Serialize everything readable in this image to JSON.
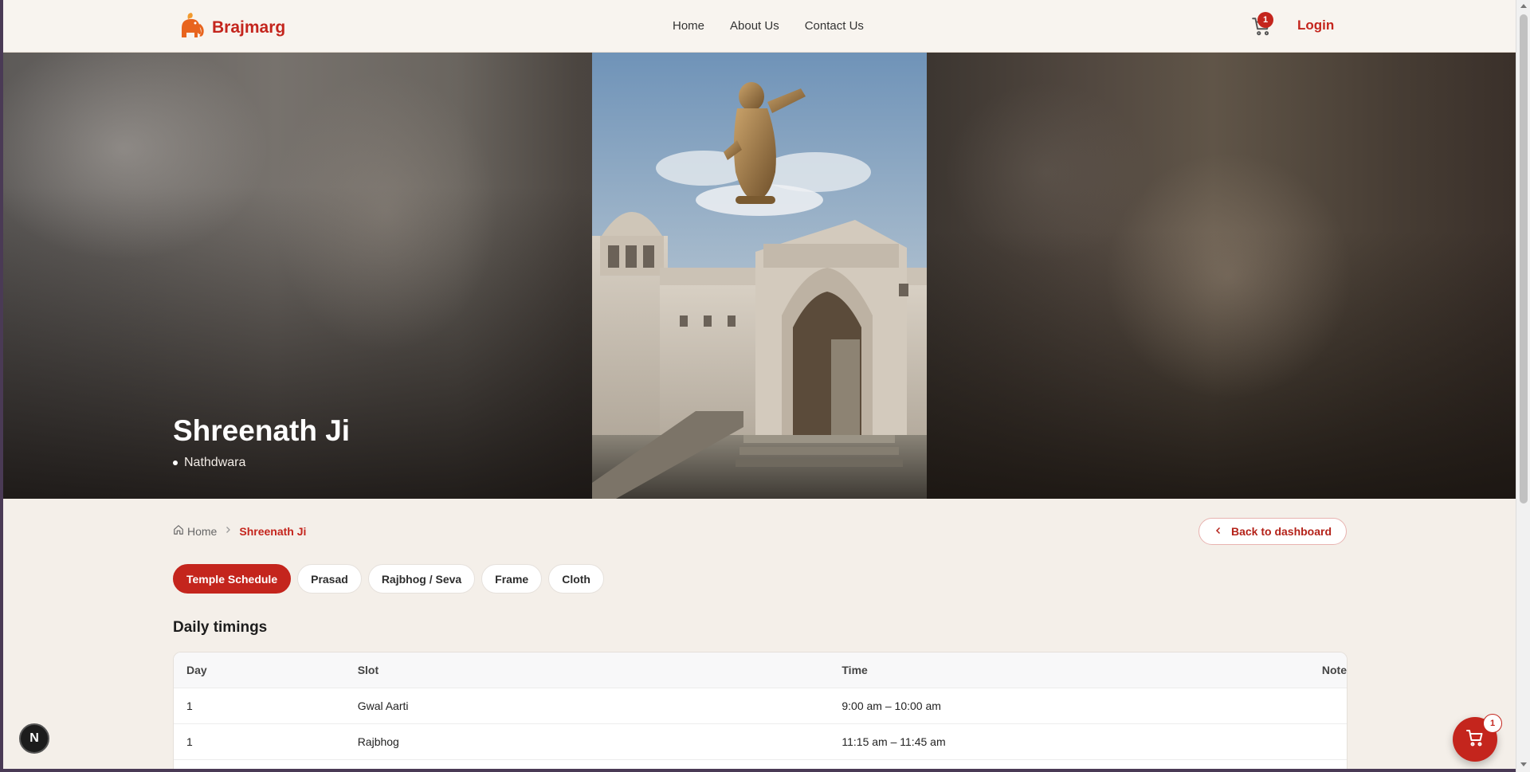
{
  "header": {
    "brand": "Brajmarg",
    "nav": [
      "Home",
      "About Us",
      "Contact Us"
    ],
    "cart_count": "1",
    "login_label": "Login"
  },
  "hero": {
    "title": "Shreenath Ji",
    "location": "Nathdwara"
  },
  "breadcrumb": {
    "home": "Home",
    "current": "Shreenath Ji"
  },
  "back_button": "Back to dashboard",
  "tabs": [
    {
      "label": "Temple Schedule",
      "active": true
    },
    {
      "label": "Prasad",
      "active": false
    },
    {
      "label": "Rajbhog / Seva",
      "active": false
    },
    {
      "label": "Frame",
      "active": false
    },
    {
      "label": "Cloth",
      "active": false
    }
  ],
  "section_title": "Daily timings",
  "schedule": {
    "headers": [
      "Day",
      "Slot",
      "Time",
      "Note"
    ],
    "rows": [
      {
        "day": "1",
        "slot": "Gwal Aarti",
        "time": "9:00 am – 10:00 am",
        "note": ""
      },
      {
        "day": "1",
        "slot": "Rajbhog",
        "time": "11:15 am – 11:45 am",
        "note": ""
      },
      {
        "day": "",
        "slot": "",
        "time": "",
        "note": ""
      }
    ]
  },
  "floating": {
    "dev_badge": "N",
    "cart_count": "1"
  },
  "colors": {
    "accent": "#c4251d",
    "page_bg": "#f4efe9"
  }
}
